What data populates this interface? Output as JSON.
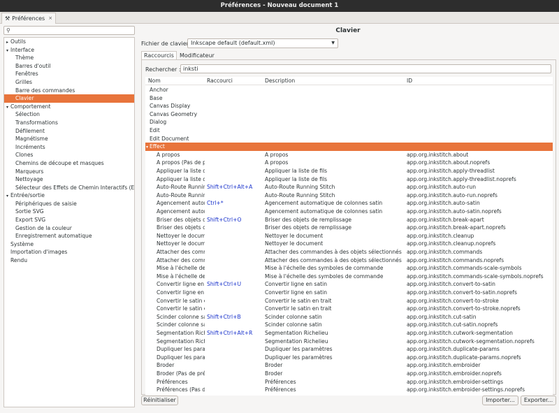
{
  "window": {
    "title": "Préférences - Nouveau document 1"
  },
  "doc_tab": {
    "label": "Préférences",
    "close": "×"
  },
  "sidebar": {
    "search_placeholder": "",
    "items": [
      {
        "label": "Outils",
        "level": 0,
        "expander": "▸"
      },
      {
        "label": "Interface",
        "level": 0,
        "expander": "▾"
      },
      {
        "label": "Thème",
        "level": 1
      },
      {
        "label": "Barres d'outil",
        "level": 1
      },
      {
        "label": "Fenêtres",
        "level": 1
      },
      {
        "label": "Grilles",
        "level": 1
      },
      {
        "label": "Barre des commandes",
        "level": 1
      },
      {
        "label": "Clavier",
        "level": 1,
        "selected": true
      },
      {
        "label": "Comportement",
        "level": 0,
        "expander": "▾"
      },
      {
        "label": "Sélection",
        "level": 1
      },
      {
        "label": "Transformations",
        "level": 1
      },
      {
        "label": "Défilement",
        "level": 1
      },
      {
        "label": "Magnétisme",
        "level": 1
      },
      {
        "label": "Incréments",
        "level": 1
      },
      {
        "label": "Clones",
        "level": 1
      },
      {
        "label": "Chemins de découpe et masques",
        "level": 1
      },
      {
        "label": "Marqueurs",
        "level": 1
      },
      {
        "label": "Nettoyage",
        "level": 1
      },
      {
        "label": "Sélecteur des Effets de Chemin Interactifs (ECI)",
        "level": 1
      },
      {
        "label": "Entrée/sortie",
        "level": 0,
        "expander": "▾"
      },
      {
        "label": "Périphériques de saisie",
        "level": 1
      },
      {
        "label": "Sortie SVG",
        "level": 1
      },
      {
        "label": "Export SVG",
        "level": 1
      },
      {
        "label": "Gestion de la couleur",
        "level": 1
      },
      {
        "label": "Enregistrement automatique",
        "level": 1
      },
      {
        "label": "Système",
        "level": 0
      },
      {
        "label": "Importation d'images",
        "level": 0
      },
      {
        "label": "Rendu",
        "level": 0
      }
    ]
  },
  "main": {
    "heading": "Clavier",
    "keyboard_file_label": "Fichier de clavier :",
    "keyboard_file_value": "Inkscape default (default.xml)",
    "tabs": [
      "Raccourcis",
      "Modificateur"
    ],
    "search_label": "Rechercher :",
    "search_value": "inksti",
    "columns": [
      "Nom",
      "Raccourci",
      "Description",
      "ID"
    ],
    "categories": [
      "Anchor",
      "Base",
      "Canvas Display",
      "Canvas Geometry",
      "Dialog",
      "Edit",
      "Edit Document"
    ],
    "group": {
      "label": "Effect",
      "expander": "▾"
    },
    "rows": [
      {
        "nom": "A propos",
        "shortcut": "",
        "desc": "A propos",
        "id": "app.org.inkstitch.about"
      },
      {
        "nom": "A propos (Pas de pr",
        "shortcut": "",
        "desc": "A propos",
        "id": "app.org.inkstitch.about.noprefs"
      },
      {
        "nom": "Appliquer la liste de",
        "shortcut": "",
        "desc": "Appliquer la liste de fils",
        "id": "app.org.inkstitch.apply-threadlist"
      },
      {
        "nom": "Appliquer la liste de",
        "shortcut": "",
        "desc": "Appliquer la liste de fils",
        "id": "app.org.inkstitch.apply-threadlist.noprefs"
      },
      {
        "nom": "Auto-Route Runnin",
        "shortcut": "Shift+Ctrl+Alt+A",
        "desc": "Auto-Route Running Stitch",
        "id": "app.org.inkstitch.auto-run"
      },
      {
        "nom": "Auto-Route Runnin",
        "shortcut": "",
        "desc": "Auto-Route Running Stitch",
        "id": "app.org.inkstitch.auto-run.noprefs"
      },
      {
        "nom": "Agencement autom",
        "shortcut": "Ctrl+*",
        "desc": "Agencement automatique de colonnes satin",
        "id": "app.org.inkstitch.auto-satin"
      },
      {
        "nom": "Agencement autom",
        "shortcut": "",
        "desc": "Agencement automatique de colonnes satin",
        "id": "app.org.inkstitch.auto-satin.noprefs"
      },
      {
        "nom": "Briser des objets de",
        "shortcut": "Shift+Ctrl+O",
        "desc": "Briser des objets de remplissage",
        "id": "app.org.inkstitch.break-apart"
      },
      {
        "nom": "Briser des objets de",
        "shortcut": "",
        "desc": "Briser des objets de remplissage",
        "id": "app.org.inkstitch.break-apart.noprefs"
      },
      {
        "nom": "Nettoyer le docume",
        "shortcut": "",
        "desc": "Nettoyer le document",
        "id": "app.org.inkstitch.cleanup"
      },
      {
        "nom": "Nettoyer le docume",
        "shortcut": "",
        "desc": "Nettoyer le document",
        "id": "app.org.inkstitch.cleanup.noprefs"
      },
      {
        "nom": "Attacher des comm",
        "shortcut": "",
        "desc": "Attacher des commandes à des objets sélectionnés",
        "id": "app.org.inkstitch.commands"
      },
      {
        "nom": "Attacher des comm",
        "shortcut": "",
        "desc": "Attacher des commandes à des objets sélectionnés",
        "id": "app.org.inkstitch.commands.noprefs"
      },
      {
        "nom": "Mise à l'échelle des",
        "shortcut": "",
        "desc": "Mise à l'échelle des symboles de commande",
        "id": "app.org.inkstitch.commands-scale-symbols"
      },
      {
        "nom": "Mise à l'échelle des",
        "shortcut": "",
        "desc": "Mise à l'échelle des symboles de commande",
        "id": "app.org.inkstitch.commands-scale-symbols.noprefs"
      },
      {
        "nom": "Convertir ligne en s",
        "shortcut": "Shift+Ctrl+U",
        "desc": "Convertir ligne en satin",
        "id": "app.org.inkstitch.convert-to-satin"
      },
      {
        "nom": "Convertir ligne en s",
        "shortcut": "",
        "desc": "Convertir ligne en satin",
        "id": "app.org.inkstitch.convert-to-satin.noprefs"
      },
      {
        "nom": "Convertir le satin e",
        "shortcut": "",
        "desc": "Convertir le satin en trait",
        "id": "app.org.inkstitch.convert-to-stroke"
      },
      {
        "nom": "Convertir le satin e",
        "shortcut": "",
        "desc": "Convertir le satin en trait",
        "id": "app.org.inkstitch.convert-to-stroke.noprefs"
      },
      {
        "nom": "Scinder colonne sat",
        "shortcut": "Shift+Ctrl+B",
        "desc": "Scinder colonne satin",
        "id": "app.org.inkstitch.cut-satin"
      },
      {
        "nom": "Scinder colonne sat",
        "shortcut": "",
        "desc": "Scinder colonne satin",
        "id": "app.org.inkstitch.cut-satin.noprefs"
      },
      {
        "nom": "Segmentation Richel",
        "shortcut": "Shift+Ctrl+Alt+R",
        "desc": "Segmentation Richelieu",
        "id": "app.org.inkstitch.cutwork-segmentation"
      },
      {
        "nom": "Segmentation Richel",
        "shortcut": "",
        "desc": "Segmentation Richelieu",
        "id": "app.org.inkstitch.cutwork-segmentation.noprefs"
      },
      {
        "nom": "Dupliquer les param",
        "shortcut": "",
        "desc": "Dupliquer les paramètres",
        "id": "app.org.inkstitch.duplicate-params"
      },
      {
        "nom": "Dupliquer les param",
        "shortcut": "",
        "desc": "Dupliquer les paramètres",
        "id": "app.org.inkstitch.duplicate-params.noprefs"
      },
      {
        "nom": "Broder",
        "shortcut": "",
        "desc": "Broder",
        "id": "app.org.inkstitch.embroider"
      },
      {
        "nom": "Broder (Pas de préf",
        "shortcut": "",
        "desc": "Broder",
        "id": "app.org.inkstitch.embroider.noprefs"
      },
      {
        "nom": "Préférences",
        "shortcut": "",
        "desc": "Préférences",
        "id": "app.org.inkstitch.embroider-settings"
      },
      {
        "nom": "Préférences (Pas de",
        "shortcut": "",
        "desc": "Préférences",
        "id": "app.org.inkstitch.embroider-settings.noprefs"
      }
    ],
    "buttons": {
      "reset": "Réinitialiser",
      "import": "Importer...",
      "export": "Exporter..."
    }
  },
  "colors": {
    "selection": "#e8743b",
    "shortcut_text": "#1a33cc",
    "titlebar": "#2d2d2d"
  }
}
